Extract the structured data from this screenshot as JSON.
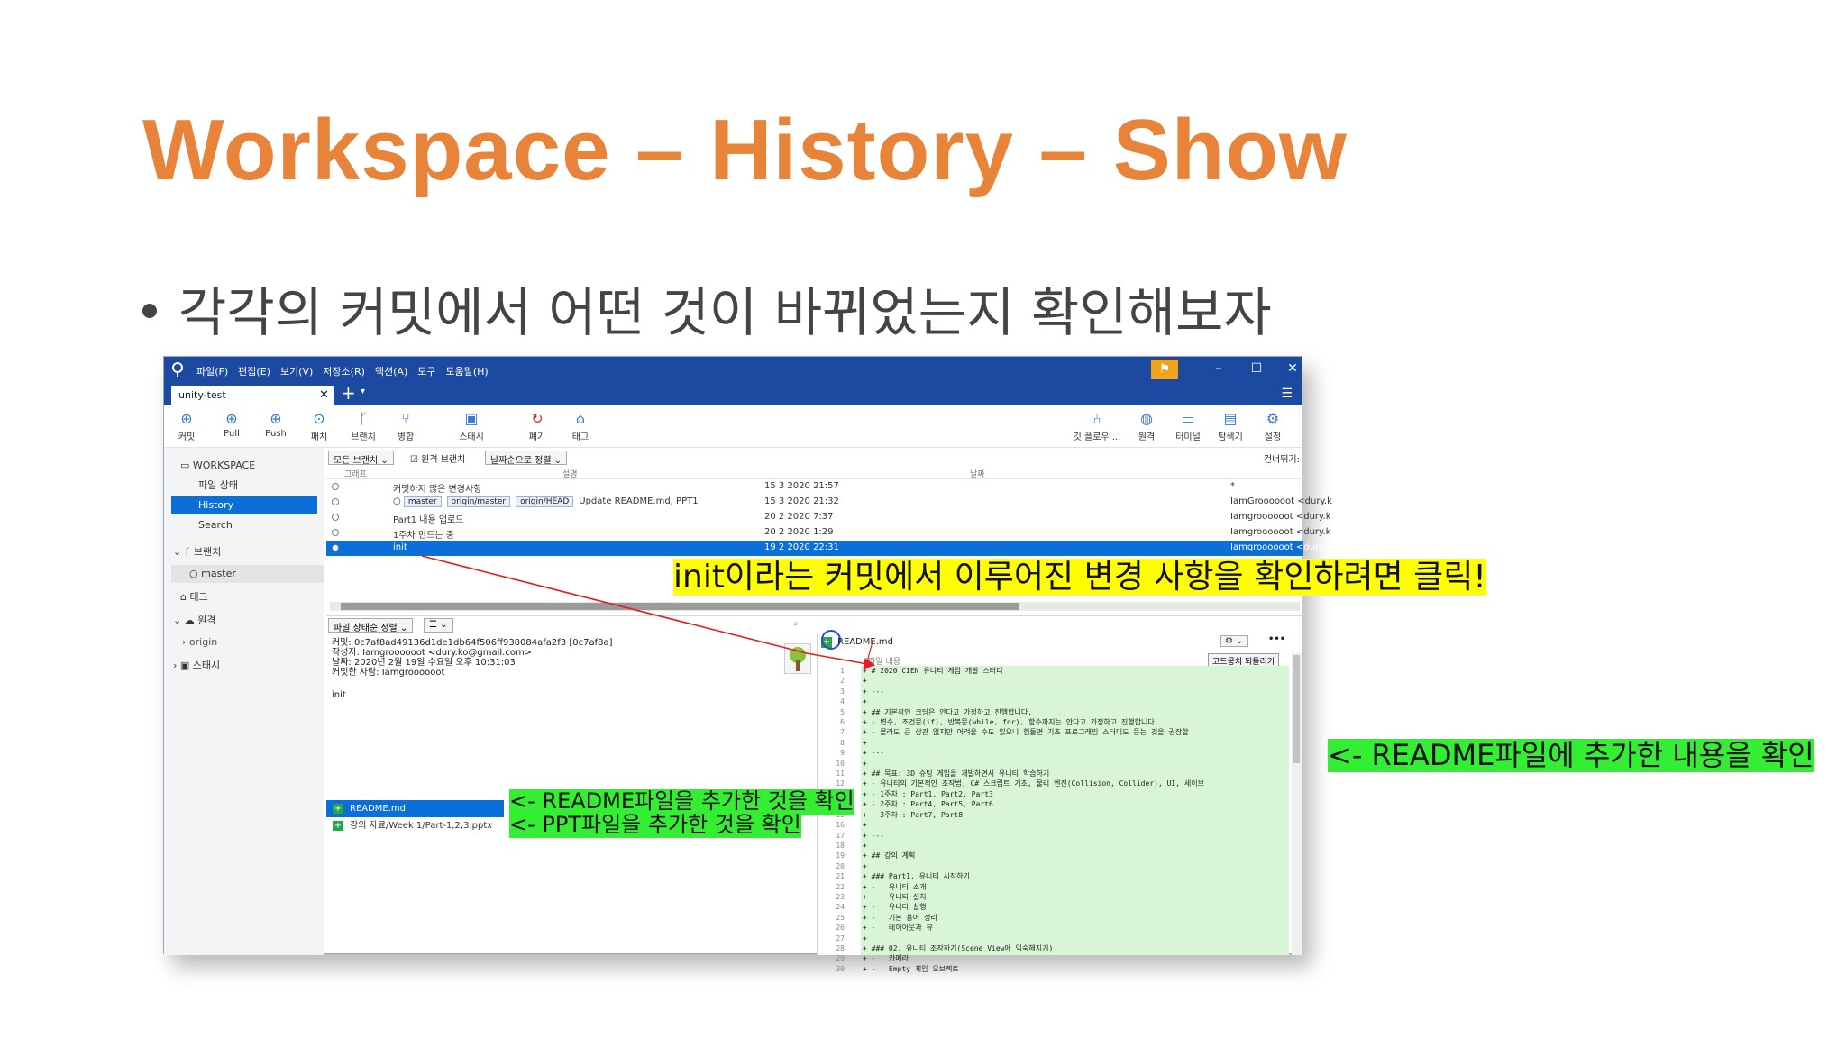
{
  "slide": {
    "title": "Workspace – History – Show",
    "bullet": "각각의 커밋에서 어떤 것이 바뀌었는지 확인해보자"
  },
  "app": {
    "menu": [
      "파일(F)",
      "편집(E)",
      "보기(V)",
      "저장소(R)",
      "액션(A)",
      "도구",
      "도움말(H)"
    ],
    "tab_label": "unity-test",
    "toolbar_left": [
      {
        "label": "커밋",
        "icon": "commit-icon"
      },
      {
        "label": "Pull",
        "icon": "pull-icon"
      },
      {
        "label": "Push",
        "icon": "push-icon"
      },
      {
        "label": "패치",
        "icon": "fetch-icon"
      },
      {
        "label": "브랜치",
        "icon": "branch-icon"
      },
      {
        "label": "병합",
        "icon": "merge-icon"
      },
      {
        "label": "스태시",
        "icon": "stash-icon"
      },
      {
        "label": "폐기",
        "icon": "discard-icon"
      },
      {
        "label": "태그",
        "icon": "tag-icon"
      }
    ],
    "toolbar_right": [
      {
        "label": "깃 플로우 ...",
        "icon": "gitflow-icon"
      },
      {
        "label": "원격",
        "icon": "remote-icon"
      },
      {
        "label": "터미널",
        "icon": "terminal-icon"
      },
      {
        "label": "탐색기",
        "icon": "explorer-icon"
      },
      {
        "label": "설정",
        "icon": "settings-icon"
      }
    ],
    "sidebar": {
      "workspace": "WORKSPACE",
      "file_status": "파일 상태",
      "history": "History",
      "search": "Search",
      "branches": "브랜치",
      "master": "master",
      "tags": "태그",
      "remotes": "원격",
      "origin": "origin",
      "stashes": "스태시"
    },
    "filter": {
      "branches": "모든 브랜치",
      "remote_branches": "원격 브랜치",
      "sort": "날짜순으로 정렬",
      "skip": "건너뛰기:"
    },
    "columns": {
      "graph": "그래프",
      "description": "설명",
      "date": "날짜"
    },
    "commits": [
      {
        "desc": "커밋하지 않은 변경사항",
        "date": "15 3 2020 21:57",
        "author": "*"
      },
      {
        "desc": "Update README.md, PPT1",
        "tags": [
          "master",
          "origin/master",
          "origin/HEAD"
        ],
        "date": "15 3 2020 21:32",
        "author": "IamGroooooot <dury.k"
      },
      {
        "desc": "Part1 내용 업로드",
        "date": "20 2 2020 7:37",
        "author": "Iamgroooooot <dury.k"
      },
      {
        "desc": "1주차 만드는 중",
        "date": "20 2 2020 1:29",
        "author": "Iamgroooooot <dury.k"
      },
      {
        "desc": "init",
        "date": "19 2 2020 22:31",
        "author": "Iamgroooooot <dury.k"
      }
    ],
    "file_status_sort": "파일 상태순 정렬",
    "commit_details": {
      "hash": "커밋: 0c7af8ad49136d1de1db64f506ff938084afa2f3 [0c7af8a]",
      "author": "작성자: Iamgroooooot <dury.ko@gmail.com>",
      "date": "날짜: 2020년 2월 19일 수요일 오후 10:31:03",
      "committer": "커밋한 사람: Iamgroooooot",
      "message": "init"
    },
    "changed_files": [
      "README.md",
      "강의 자료/Week 1/Part-1,2,3.pptx"
    ],
    "diff": {
      "filename": "README.md",
      "content_label": "파일 내용",
      "revert": "코드뭉치 되돌리기",
      "lines": [
        "+ # 2020 CIEN 유니티 게임 개발 스터디",
        "+",
        "+ ---",
        "+",
        "+ ## 기본적인 코딩은 안다고 가정하고 진행합니다.",
        "+ - 변수, 조건문(if), 반복문(while, for), 함수까지는 안다고 가정하고 진행합니다.",
        "+ - 몰라도 큰 상관 없지만 어려울 수도 있으니 힘들면 기초 프로그래밍 스터디도 듣는 것을 권장합",
        "+",
        "+ ---",
        "+",
        "+ ## 목표: 3D 슈팅 게임을 개발하면서 유니티 학습하기",
        "+ - 유니티의 기본적인 조작법, C# 스크립트 기초, 물리 엔진(Collision, Collider), UI, 세이브",
        "+ - 1주차 : Part1, Part2, Part3",
        "+ - 2주차 : Part4, Part5, Part6",
        "+ - 3주차 : Part7, Part8",
        "+",
        "+ ---",
        "+",
        "+ ## 강의 계획",
        "+",
        "+ ### Part1. 유니티 시작하기",
        "+ -   유니티 소개",
        "+ -   유니티 설치",
        "+ -   유니티 실행",
        "+ -   기본 용어 정리",
        "+ -   레이아웃과 뷰",
        "+",
        "+ ### 02. 유니티 조작하기(Scene View에 익숙해지기)",
        "+ -   카메라",
        "+ -   Empty 게임 오브젝트"
      ]
    }
  },
  "annotations": {
    "init_click": "init이라는 커밋에서 이루어진 변경 사항을 확인하려면 클릭!",
    "readme_added": "<- README파일을 추가한 것을 확인",
    "ppt_added": "<- PPT파일을 추가한 것을 확인",
    "readme_content": "<- README파일에 추가한 내용을 확인"
  },
  "colors": {
    "title": "#e8833a",
    "titlebar": "#1c4aa0",
    "selection": "#0a6fd8",
    "annotation_yellow": "#ffff00",
    "annotation_green": "#33ee33",
    "arrow": "#e02020",
    "diff_added_bg": "#d8f6d5"
  }
}
